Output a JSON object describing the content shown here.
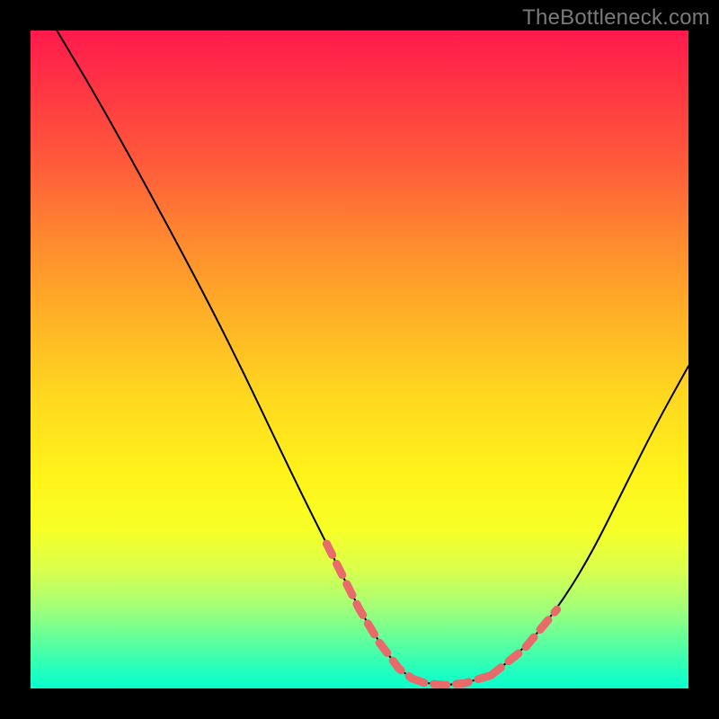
{
  "watermark": "TheBottleneck.com",
  "colors": {
    "frame": "#000000",
    "gradient_top": "#ff1a4d",
    "gradient_bottom": "#0affcc",
    "curve": "#000000",
    "highlight": "#e96a6a"
  },
  "chart_data": {
    "type": "line",
    "title": "",
    "xlabel": "",
    "ylabel": "",
    "xlim": [
      0,
      100
    ],
    "ylim": [
      0,
      100
    ],
    "grid": false,
    "series": [
      {
        "name": "curve",
        "x": [
          4,
          10,
          20,
          30,
          40,
          45,
          50,
          53,
          56,
          58,
          60,
          63,
          66,
          70,
          75,
          80,
          85,
          90,
          95,
          100
        ],
        "y": [
          100,
          90,
          72,
          53,
          32,
          22,
          12,
          7,
          3,
          1.5,
          0.8,
          0.5,
          0.8,
          2,
          6,
          12,
          20,
          30,
          40,
          49
        ]
      }
    ],
    "highlight_segments": [
      {
        "x": [
          45,
          50,
          53,
          56,
          58
        ],
        "y": [
          22,
          12,
          7,
          3,
          1.5
        ]
      },
      {
        "x": [
          58,
          60,
          63,
          66,
          70
        ],
        "y": [
          1.5,
          0.8,
          0.5,
          0.8,
          2
        ]
      },
      {
        "x": [
          70,
          75,
          80
        ],
        "y": [
          2,
          6,
          12
        ]
      }
    ]
  }
}
